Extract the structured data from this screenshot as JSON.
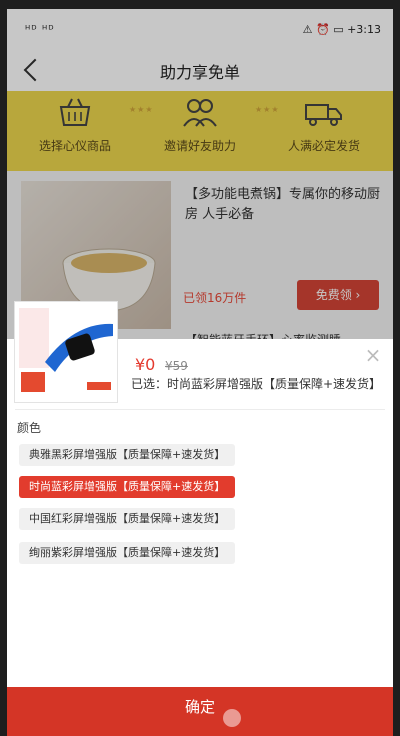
{
  "status_bar": {
    "left": "ᴴᴰ ᴴᴰ",
    "right": "⚠ ⏰ ▭ +3:13"
  },
  "nav": {
    "title": "助力享免单"
  },
  "steps": [
    {
      "label": "选择心仪商品",
      "icon": "basket-icon"
    },
    {
      "label": "邀请好友助力",
      "icon": "friends-icon"
    },
    {
      "label": "人满必定发货",
      "icon": "truck-icon"
    }
  ],
  "product": {
    "description": "【多功能电煮锅】专属你的移动厨房 人手必备",
    "claimed": "已领16万件",
    "free_button": "免费领 ›",
    "next_title": "【智能蓝牙手环】心率监测睡"
  },
  "sheet": {
    "price": "¥0",
    "old_price": "¥59",
    "selected": "已选：时尚蓝彩屏增强版【质量保障+速发货】",
    "section_label": "颜色",
    "options": [
      {
        "label": "典雅黑彩屏增强版【质量保障+速发货】",
        "active": false
      },
      {
        "label": "时尚蓝彩屏增强版【质量保障+速发货】",
        "active": true
      },
      {
        "label": "中国红彩屏增强版【质量保障+速发货】",
        "active": false
      },
      {
        "label": "绚丽紫彩屏增强版【质量保障+速发货】",
        "active": false
      }
    ],
    "confirm": "确定",
    "close": "×"
  },
  "colors": {
    "accent": "#e23c2d",
    "banner": "#ecd64e",
    "confirm": "#d43526"
  }
}
